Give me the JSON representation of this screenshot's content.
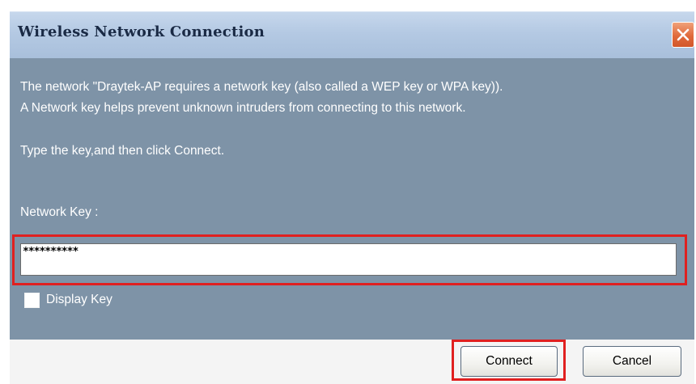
{
  "window": {
    "title": "Wireless Network Connection"
  },
  "message": {
    "line1": "The network \"Draytek-AP  requires a network key (also called a WEP key or WPA key)).",
    "line2": "A Network key helps prevent unknown intruders from connecting to this network.",
    "instruction": "Type the key,and then click Connect."
  },
  "network_key": {
    "label": "Network Key :",
    "value": "**********"
  },
  "display_key": {
    "label": "Display Key",
    "checked": false
  },
  "buttons": {
    "connect_label": "Connect",
    "cancel_label": "Cancel"
  },
  "colors": {
    "title_bar": "#b4c9e3",
    "panel": "#7e93a7",
    "highlight": "#e02020",
    "close_button": "#e06a3c"
  },
  "icons": {
    "close": "close-x-icon"
  }
}
